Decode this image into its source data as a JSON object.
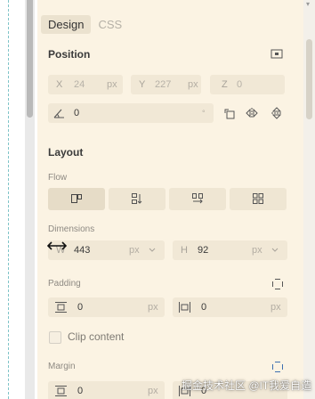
{
  "tabs": [
    {
      "label": "Design",
      "active": true
    },
    {
      "label": "CSS",
      "active": false
    }
  ],
  "position": {
    "title": "Position",
    "x": {
      "label": "X",
      "value": "24",
      "unit": "px"
    },
    "y": {
      "label": "Y",
      "value": "227",
      "unit": "px"
    },
    "z": {
      "label": "Z",
      "value": "0"
    },
    "rotation": {
      "value": "0",
      "unit": "°"
    }
  },
  "layout": {
    "title": "Layout",
    "flow_label": "Flow",
    "flow_options": [
      "free-layout-icon",
      "vertical-flow-icon",
      "horizontal-flow-icon",
      "grid-icon"
    ],
    "dimensions_label": "Dimensions",
    "width": {
      "label": "W",
      "value": "443",
      "unit": "px"
    },
    "height": {
      "label": "H",
      "value": "92",
      "unit": "px"
    },
    "padding_label": "Padding",
    "padding_vertical": {
      "value": "0",
      "unit": "px"
    },
    "padding_horizontal": {
      "value": "0",
      "unit": "px"
    },
    "clip_content_label": "Clip content",
    "margin_label": "Margin",
    "margin_vertical": {
      "value": "0",
      "unit": "px"
    },
    "margin_horizontal": {
      "value": "0"
    }
  },
  "watermark": "掘金技术社区 @IT我爱自造",
  "colors": {
    "panel_bg": "#fbf3e3",
    "field_bg": "#f1e8d6",
    "accent": "#3d6fb0"
  }
}
